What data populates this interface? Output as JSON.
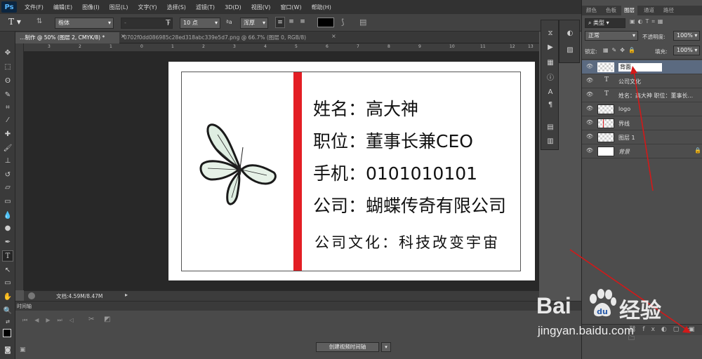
{
  "app": {
    "logo": "Ps",
    "menus": [
      "文件(F)",
      "编辑(E)",
      "图像(I)",
      "图层(L)",
      "文字(Y)",
      "选择(S)",
      "滤镜(T)",
      "3D(D)",
      "视图(V)",
      "窗口(W)",
      "帮助(H)"
    ]
  },
  "options": {
    "font_family": "楷体",
    "font_style": "-",
    "font_size": "10 点",
    "aa_icon": "ªa",
    "antialias": "浑厚",
    "tool_icon": "T"
  },
  "tabs": [
    {
      "label": "…制作 @ 50% (图层 2, CMYK/8) *",
      "close": "×"
    },
    {
      "label": "0702f0dd086985c28ed318abc339e5d7.png @ 66.7% (图层 0, RGB/8)",
      "close": "×"
    }
  ],
  "ruler": {
    "ticks": [
      "3",
      "2",
      "1",
      "0",
      "1",
      "2",
      "3",
      "4",
      "5",
      "6",
      "7",
      "8",
      "9",
      "10",
      "11",
      "12",
      "13"
    ]
  },
  "card": {
    "lines": [
      "姓名：高大神",
      "职位：董事长兼CEO",
      "手机：0101010101",
      "公司：蝴蝶传奇有限公司"
    ],
    "culture": "公司文化：科技改变宇宙"
  },
  "status": {
    "doc": "文档:4.59M/8.47M"
  },
  "timeline": {
    "title": "时间轴",
    "create_button": "创建视频时间轴"
  },
  "layers_panel": {
    "tabs": [
      "颜色",
      "色板",
      "图层",
      "通道",
      "路径"
    ],
    "kind": "类型",
    "blend": "正常",
    "opacity_label": "不透明度:",
    "opacity": "100%",
    "lock_label": "锁定:",
    "fill_label": "填充:",
    "fill": "100%",
    "layers": [
      {
        "name": "背面",
        "type": "raster-check",
        "editing": true
      },
      {
        "name": "公司文化",
        "type": "text"
      },
      {
        "name": "姓名：高大神 职位：董事长...",
        "type": "text"
      },
      {
        "name": "logo",
        "type": "raster-check"
      },
      {
        "name": "界线",
        "type": "raster-check"
      },
      {
        "name": "图层 1",
        "type": "raster-check"
      },
      {
        "name": "背景",
        "type": "white",
        "locked": true
      }
    ]
  },
  "watermark": {
    "brand_left": "Bai",
    "brand_right": "经验",
    "url": "jingyan.baidu.com"
  },
  "colors": {
    "accent_red": "#e31e24",
    "arrow": "#d31919"
  }
}
